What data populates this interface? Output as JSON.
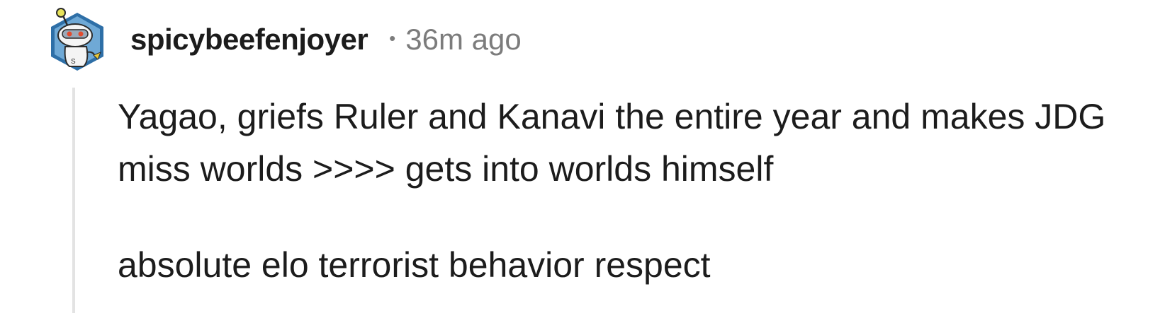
{
  "comment": {
    "author": "spicybeefenjoyer",
    "separator": "•",
    "timestamp": "36m ago",
    "avatar_icon": "reddit-snoo-avatar-icon",
    "paragraphs": [
      "Yagao, griefs Ruler and Kanavi the entire year and makes JDG miss worlds >>>> gets into worlds himself",
      "absolute elo terrorist behavior respect"
    ]
  },
  "colors": {
    "text": "#1c1c1c",
    "meta": "#7c7c7c",
    "thread_line": "#e3e3e3",
    "avatar_bg": "#2e6fa7"
  }
}
